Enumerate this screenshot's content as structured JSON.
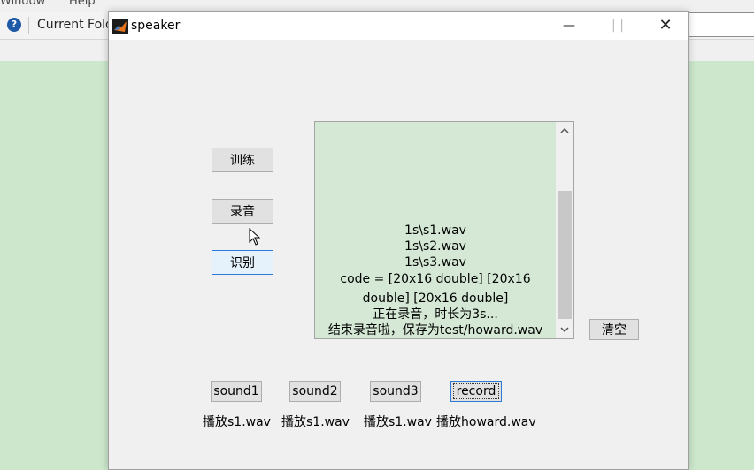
{
  "background": {
    "menu_items": [
      "Window",
      "Help"
    ],
    "toolbar": {
      "help_icon": "help-icon",
      "current_folder_label": "Current Fold"
    }
  },
  "window": {
    "title": "speaker",
    "app_icon": "matlab-icon",
    "controls": {
      "minimize": "—",
      "maximize": "|  |",
      "close": "✕"
    }
  },
  "buttons": {
    "train": "训练",
    "record_cn": "录音",
    "recognize": "识别",
    "clear": "清空",
    "sound1": "sound1",
    "sound2": "sound2",
    "sound3": "sound3",
    "record": "record"
  },
  "listbox": {
    "lines": [
      "1s\\s1.wav",
      "1s\\s2.wav",
      "1s\\s3.wav",
      "code =     [20x16 double]    [20x16",
      "double]    [20x16 double]",
      "正在录音，时长为3s...",
      "结束录音啦，保存为test/howard.wav"
    ],
    "scroll_up": "^",
    "scroll_down": "v"
  },
  "labels": {
    "play1": "播放s1.wav",
    "play2": "播放s1.wav",
    "play3": "播放s1.wav",
    "play4": "播放howard.wav"
  },
  "colors": {
    "listbox_bg": "#d5e8d5",
    "desktop_green": "#cce7cc",
    "focus_blue": "#2a7ad6"
  }
}
